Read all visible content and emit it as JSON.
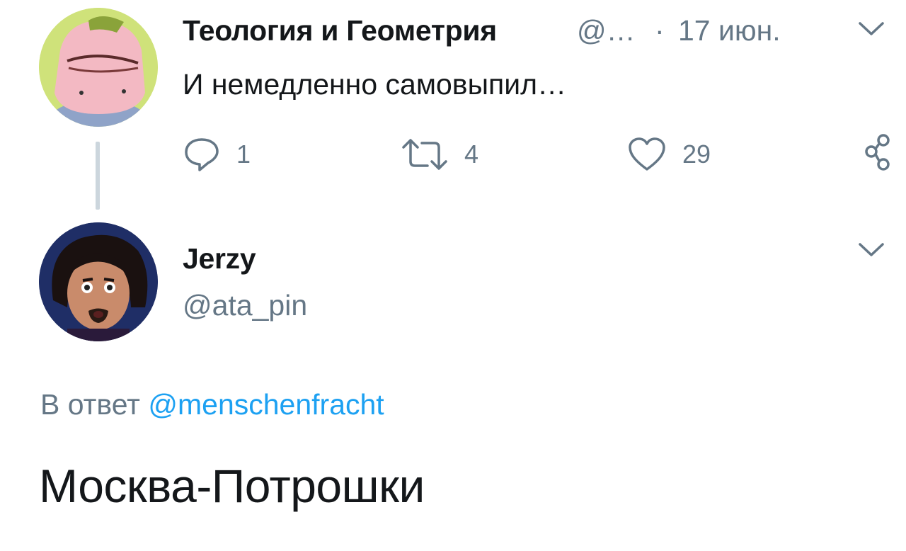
{
  "tweet1": {
    "author_name": "Теология и Геометрия",
    "handle_truncated": "@…",
    "dot": "·",
    "date": "17 июн.",
    "text": "И немедленно самовыпил…",
    "actions": {
      "reply_icon": "reply-icon",
      "reply_count": "1",
      "retweet_icon": "retweet-icon",
      "retweet_count": "4",
      "like_icon": "heart-icon",
      "like_count": "29",
      "share_icon": "share-icon"
    },
    "menu_icon": "chevron-down-icon"
  },
  "tweet2": {
    "author_name": "Jerzy",
    "handle": "@ata_pin",
    "menu_icon": "chevron-down-icon",
    "reply_prefix": "В ответ",
    "reply_handle": "@menschenfracht",
    "text": "Москва-Потрошки"
  },
  "colors": {
    "text": "#14171a",
    "secondary": "#657786",
    "link": "#1da1f2",
    "thread_line": "#ccd6dd"
  }
}
